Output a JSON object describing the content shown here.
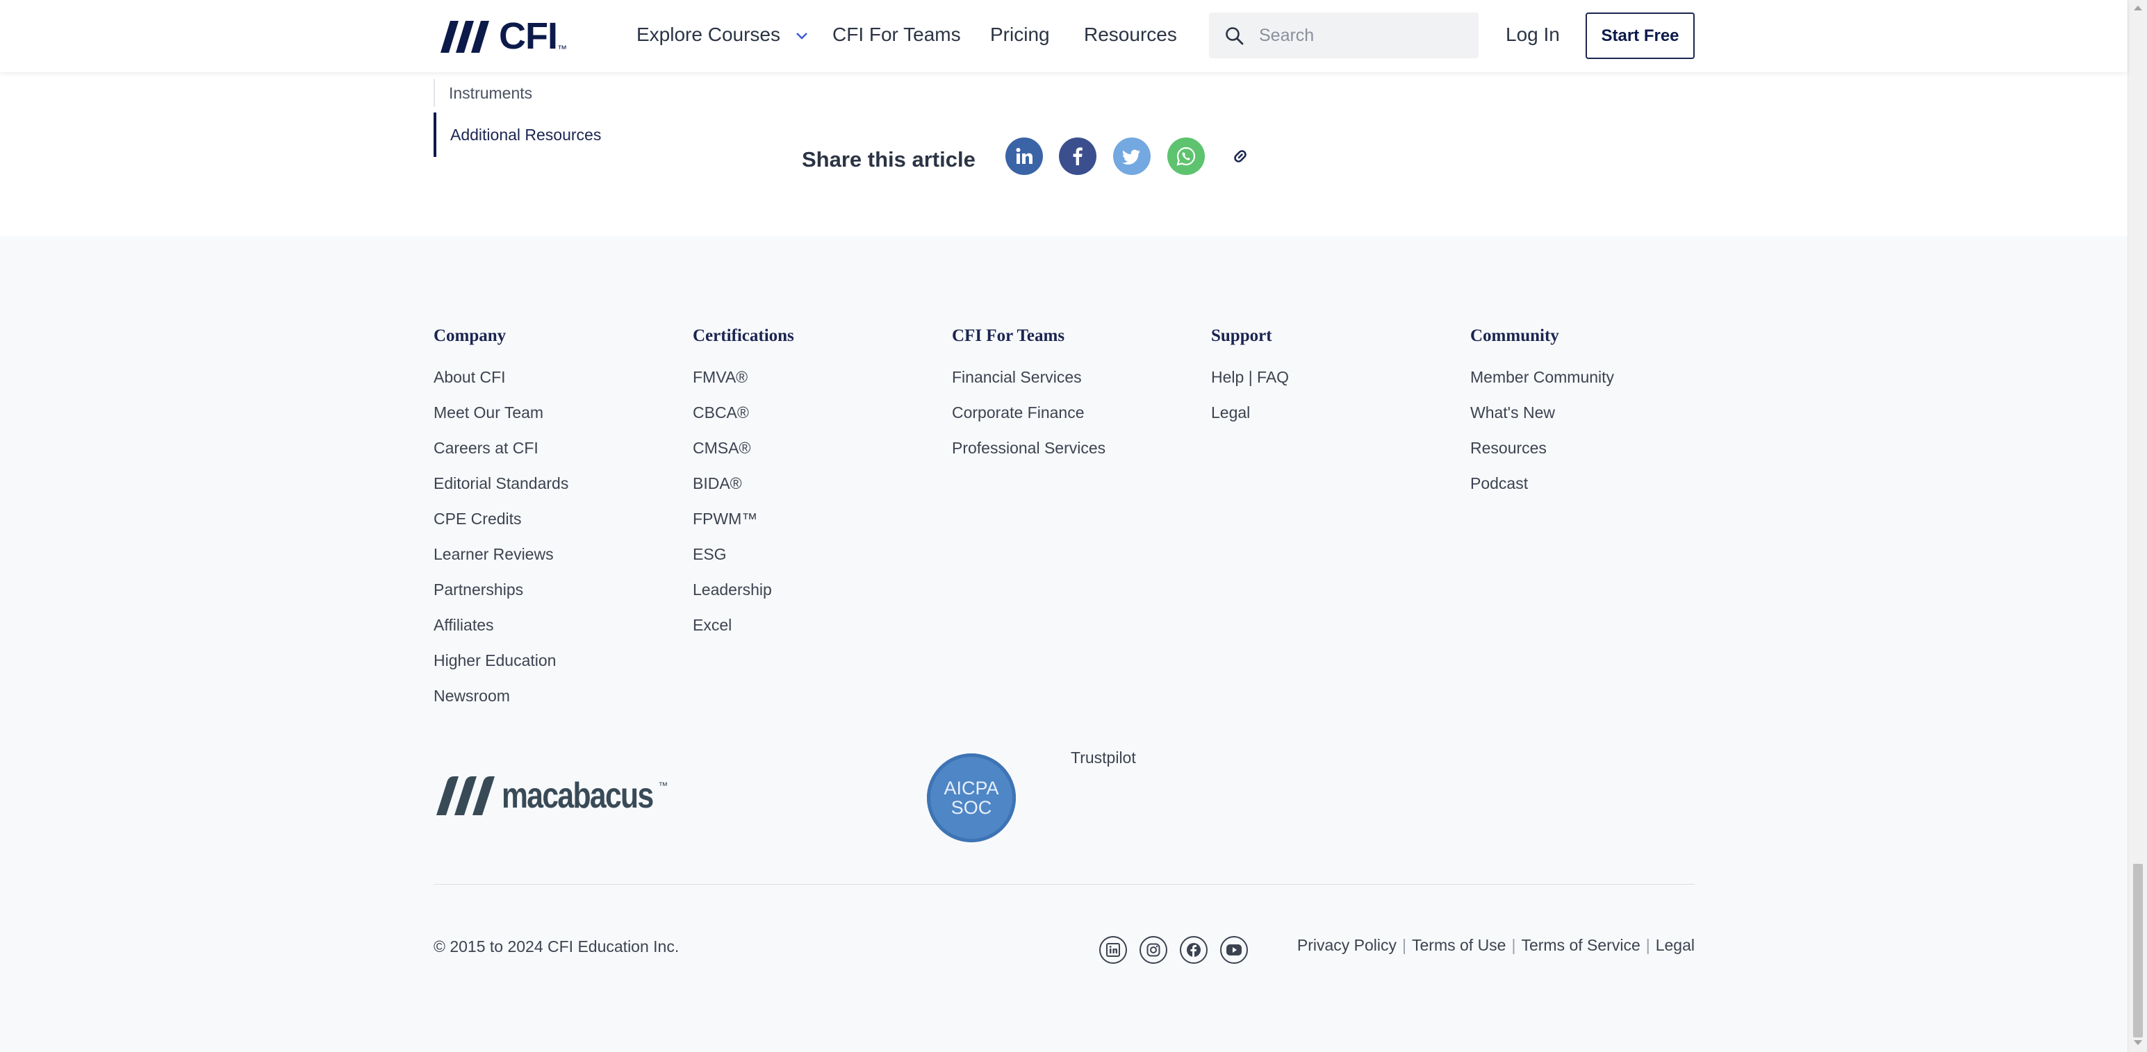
{
  "header": {
    "logo_text": "CFI",
    "logo_tm": "™",
    "nav": {
      "explore_courses": "Explore Courses",
      "cfi_for_teams": "CFI For Teams",
      "pricing": "Pricing",
      "resources": "Resources"
    },
    "search_placeholder": "Search",
    "login": "Log In",
    "start_free": "Start Free"
  },
  "toc": {
    "items": [
      "Instruments",
      "Additional Resources"
    ]
  },
  "share": {
    "label": "Share this article",
    "icons": [
      "linkedin-icon",
      "facebook-icon",
      "twitter-icon",
      "whatsapp-icon",
      "link-icon"
    ],
    "colors": {
      "linkedin": "#3b64a6",
      "facebook": "#3b4f8f",
      "twitter": "#74a8e0",
      "whatsapp": "#5ec36e"
    }
  },
  "footer": {
    "columns": [
      {
        "heading": "Company",
        "links": [
          "About CFI",
          "Meet Our Team",
          "Careers at CFI",
          "Editorial Standards",
          "CPE Credits",
          "Learner Reviews",
          "Partnerships",
          "Affiliates",
          "Higher Education",
          "Newsroom"
        ]
      },
      {
        "heading": "Certifications",
        "links": [
          "FMVA®",
          "CBCA®",
          "CMSA®",
          "BIDA®",
          "FPWM™",
          "ESG",
          "Leadership",
          "Excel"
        ]
      },
      {
        "heading": "CFI For Teams",
        "links": [
          "Financial Services",
          "Corporate Finance",
          "Professional Services"
        ]
      },
      {
        "heading": "Support",
        "links": [
          "Help | FAQ",
          "Legal"
        ]
      },
      {
        "heading": "Community",
        "links": [
          "Member Community",
          "What's New",
          "Resources",
          "Podcast"
        ]
      }
    ],
    "macabacus_text": "macabacus",
    "macabacus_tm": "™",
    "aicpa_line1": "AICPA",
    "aicpa_line2": "SOC",
    "trustpilot": "Trustpilot",
    "copyright": "© 2015 to 2024 CFI Education Inc.",
    "social_icons": [
      "linkedin-icon",
      "instagram-icon",
      "facebook-icon",
      "youtube-icon"
    ],
    "legal_links": [
      "Privacy Policy",
      "Terms of Use",
      "Terms of Service",
      "Legal"
    ]
  }
}
